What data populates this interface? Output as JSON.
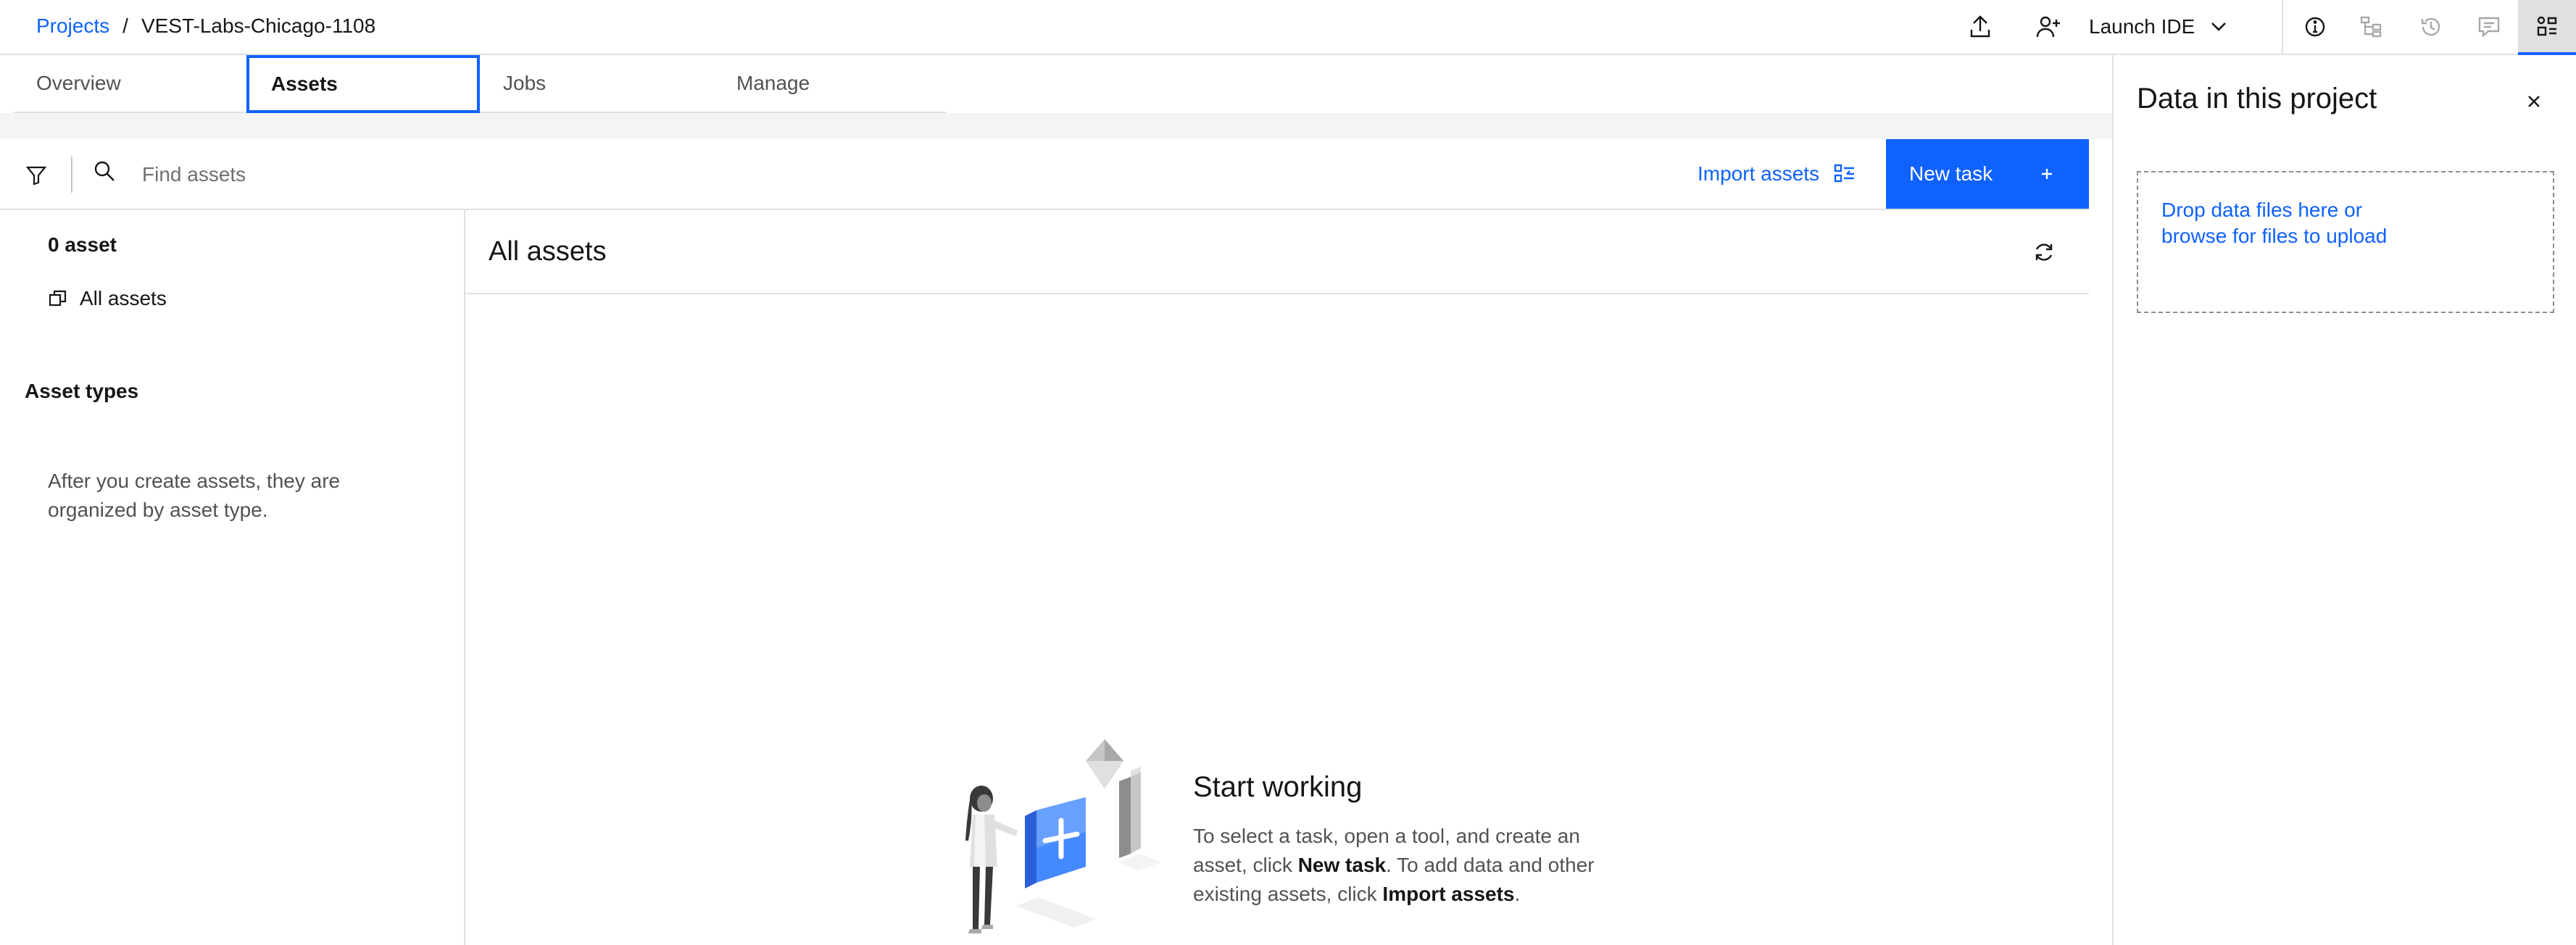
{
  "breadcrumb": {
    "projects_link": "Projects",
    "separator": "/",
    "current": "VEST-Labs-Chicago-1108"
  },
  "header": {
    "launch_ide": "Launch IDE"
  },
  "tabs": [
    {
      "label": "Overview"
    },
    {
      "label": "Assets"
    },
    {
      "label": "Jobs"
    },
    {
      "label": "Manage"
    }
  ],
  "toolbar": {
    "search_placeholder": "Find assets",
    "import_label": "Import assets",
    "new_task_label": "New task"
  },
  "left_panel": {
    "asset_count": "0 asset",
    "all_assets": "All assets",
    "asset_types_heading": "Asset types",
    "empty_types_text": "After you create assets, they are organized by asset type."
  },
  "main": {
    "title": "All assets",
    "empty_title": "Start working",
    "empty_desc_1": "To select a task, open a tool, and create an asset, click ",
    "empty_desc_bold_1": "New task",
    "empty_desc_2": ". To add data and other existing assets, click ",
    "empty_desc_bold_2": "Import assets",
    "empty_desc_3": "."
  },
  "right_panel": {
    "title": "Data in this project",
    "dropzone_text": "Drop data files here or browse for files to upload"
  },
  "colors": {
    "accent": "#0f62fe",
    "border": "#e0e0e0",
    "band": "#f4f4f4"
  },
  "icons": [
    "upload-icon",
    "add-user-icon",
    "chevron-down-icon",
    "info-icon",
    "lineage-icon",
    "history-icon",
    "comment-icon",
    "data-panel-icon",
    "filter-icon",
    "search-icon",
    "import-icon",
    "plus-icon",
    "copy-icon",
    "refresh-icon",
    "close-icon"
  ]
}
